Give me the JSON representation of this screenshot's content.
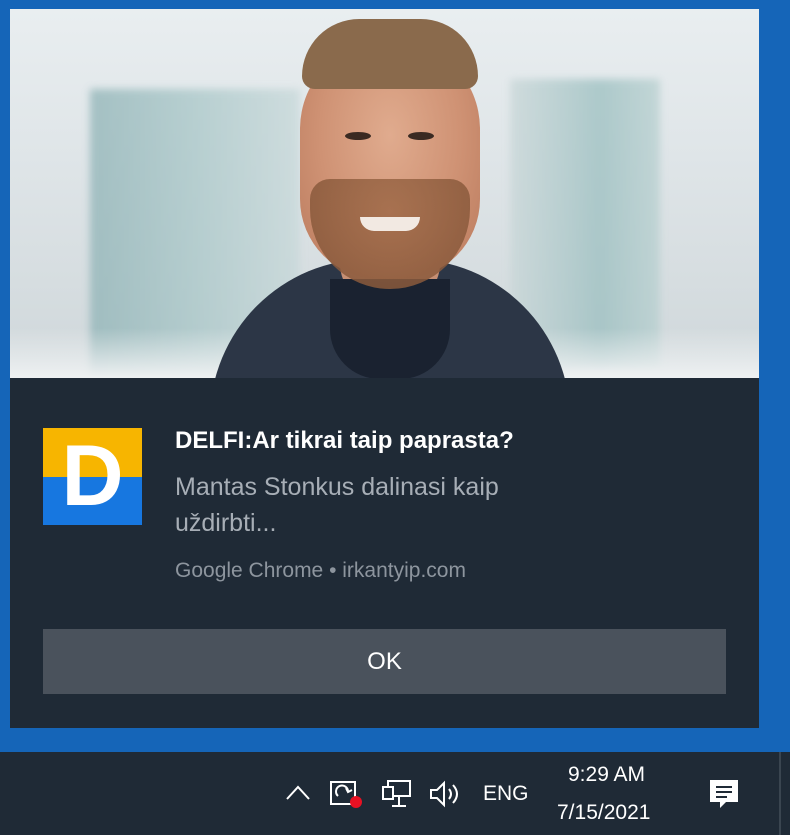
{
  "notification": {
    "title": "DELFI:Ar tikrai taip paprasta?",
    "body": "Mantas Stonkus dalinasi kaip uždirbti...",
    "source": "Google Chrome • irkantyip.com",
    "ok_label": "OK",
    "icon_letter": "D",
    "icon_colors": {
      "top": "#f7b500",
      "bottom": "#1777e0"
    }
  },
  "taskbar": {
    "language": "ENG",
    "time": "9:29 AM",
    "date": "7/15/2021",
    "icons": [
      "chevron-up-icon",
      "chrome-sync-icon",
      "network-icon",
      "volume-icon",
      "action-center-icon"
    ]
  },
  "colors": {
    "desktop": "#1565b8",
    "toast_bg": "#1f2a36",
    "button_bg": "#4a525c"
  }
}
